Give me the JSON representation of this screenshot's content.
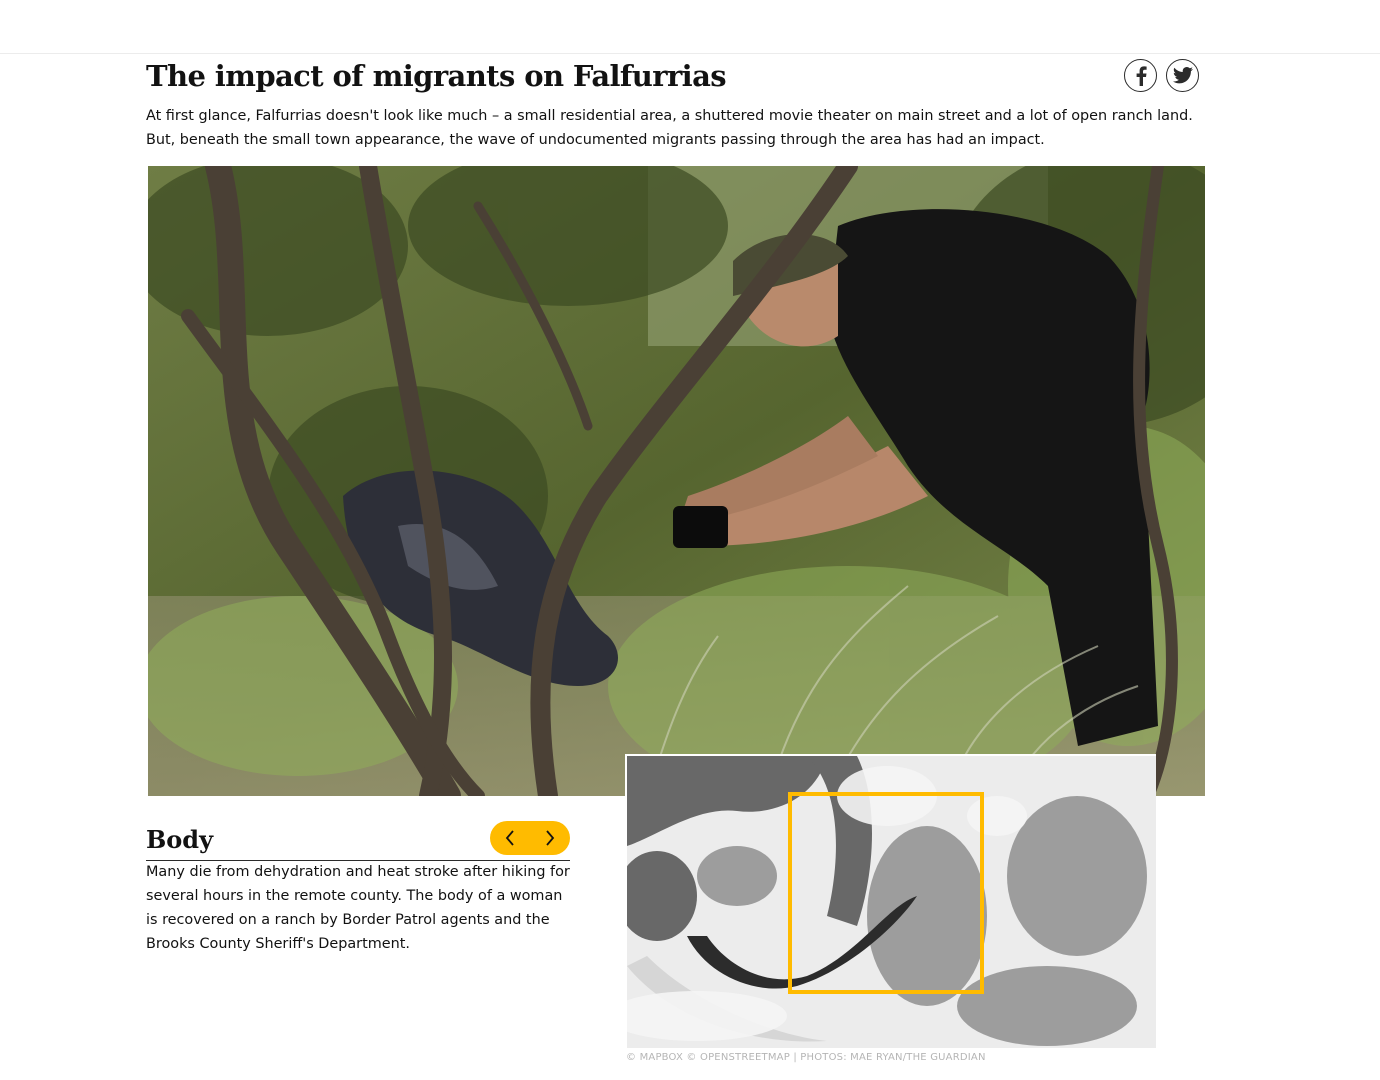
{
  "article": {
    "headline": "The impact of migrants on Falfurrias",
    "standfirst": "At first glance, Falfurrias doesn't look like much – a small residential area, a shuttered movie theater on main street and a lot of open ranch land. But, beneath the small town appearance, the wave of undocumented migrants passing through the area has had an impact."
  },
  "share": [
    {
      "icon": "facebook-icon"
    },
    {
      "icon": "twitter-icon"
    }
  ],
  "slide": {
    "title": "Body",
    "caption": "Many die from dehydration and heat stroke after hiking for several hours in the remote county. The body of a woman is recovered on a ranch by Border Patrol agents and the Brooks County Sheriff's Department.",
    "prev_icon": "chevron-left-icon",
    "next_icon": "chevron-right-icon"
  },
  "map": {
    "credit": "© MAPBOX © OPENSTREETMAP | PHOTOS: MAE RYAN/THE GUARDIAN"
  },
  "colors": {
    "accent": "#ffbb00",
    "text": "#121212",
    "credit": "#b5b5b5"
  }
}
